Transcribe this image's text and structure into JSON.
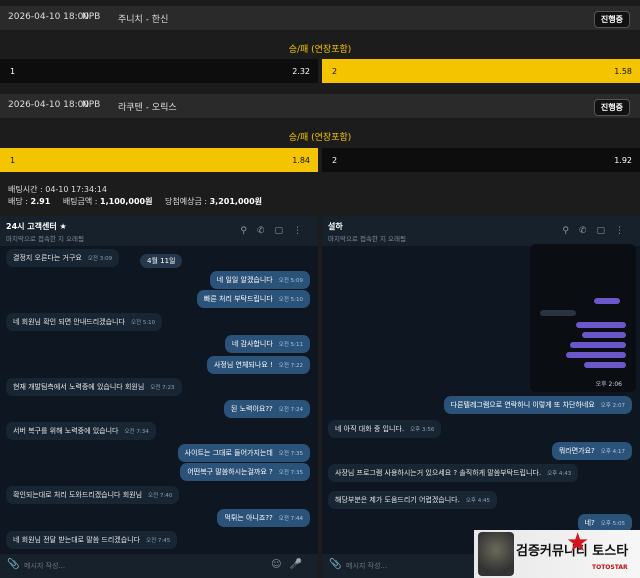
{
  "bets": [
    {
      "date": "2026-04-10 18:00",
      "league": "NPB",
      "match": "주니치 - 한신",
      "status": "진행중",
      "market": "승/패 (연장포함)",
      "options": [
        {
          "label": "1",
          "odds": "2.32",
          "selected": false
        },
        {
          "label": "2",
          "odds": "1.58",
          "selected": true
        }
      ]
    },
    {
      "date": "2026-04-10 18:00",
      "league": "NPB",
      "match": "라쿠텐 - 오릭스",
      "status": "진행중",
      "market": "승/패 (연장포함)",
      "options": [
        {
          "label": "1",
          "odds": "1.84",
          "selected": true
        },
        {
          "label": "2",
          "odds": "1.92",
          "selected": false
        }
      ]
    }
  ],
  "bet_summary": {
    "time_label": "배팅시간 :",
    "time_value": "04-10 17:34:14",
    "odds_label": "배당 :",
    "odds_value": "2.91",
    "amount_label": "배팅금액 :",
    "amount_value": "1,100,000원",
    "win_label": "당첨예상금 :",
    "win_value": "3,201,000원"
  },
  "left_chat": {
    "name": "24시 고객센터 ★",
    "status": "마지막으로 접속한 지 오래됨",
    "date_pill": "4월 11일",
    "input_placeholder": "메시지 작성...",
    "messages": [
      {
        "dir": "in",
        "text": "결정지 오른다는 거구요",
        "time": "오전 3:09"
      },
      {
        "dir": "out",
        "text": "네 일일 알겠습니다",
        "time": "오전 5:09"
      },
      {
        "dir": "out",
        "text": "빠른 처리 부탁드립니다",
        "time": "오전 5:10"
      },
      {
        "dir": "in",
        "text": "네 회원님 확인 되면 안내드리겠습니다",
        "time": "오전 5:10"
      },
      {
        "dir": "out",
        "text": "네 감사합니다",
        "time": "오전 5:11"
      },
      {
        "dir": "out",
        "text": "사정님 연체되나요 !",
        "time": "오전 7:22"
      },
      {
        "dir": "in",
        "text": "현재 개발팀측에서 노력중에 있습니다 회원님",
        "time": "오전 7:23"
      },
      {
        "dir": "out",
        "text": "된 노력이요??",
        "time": "오전 7:24"
      },
      {
        "dir": "in",
        "text": "서버 복구를 위해 노력중에 있습니다",
        "time": "오전 7:34"
      },
      {
        "dir": "out",
        "text": "사이트는 그대로 들어가지는데",
        "time": "오전 7:35"
      },
      {
        "dir": "out",
        "text": "어떤복구 말씀하시는걸까요 ?",
        "time": "오전 7:35"
      },
      {
        "dir": "in",
        "text": "확인되는대로 처리 도와드리겠습니다 회원님",
        "time": "오전 7:40"
      },
      {
        "dir": "out",
        "text": "먹튀는 아니죠??",
        "time": "오전 7:44"
      },
      {
        "dir": "in",
        "text": "네 회원님 전달 받는대로 말씀 드리겠습니다",
        "time": "오전 7:45"
      }
    ]
  },
  "right_chat": {
    "name": "설하",
    "status": "마지막으로 접속한 지 오래됨",
    "input_placeholder": "메시지 작성...",
    "photo_time": "오후 2:06",
    "photo_caption": "",
    "messages": [
      {
        "dir": "out",
        "text": "다른텔레그램으로 연락하니 이렇게 또 차단하네요",
        "time": "오후 2:07"
      },
      {
        "dir": "in",
        "text": "네 아직 대화 중 입니다.",
        "time": "오후 3:56"
      },
      {
        "dir": "out",
        "text": "뭐라면가요?",
        "time": "오후 4:17"
      },
      {
        "dir": "in",
        "text": "사장님 프로그램 사용하시는거 있으세요 ? 솔직하게 말씀부탁드립니다.",
        "time": "오후 4:43"
      },
      {
        "dir": "in",
        "text": "해당부분은 제가 도움드리기 어렵겠습니다.",
        "time": "오후 4:45"
      },
      {
        "dir": "out",
        "text": "네?",
        "time": "오후 5:05"
      }
    ]
  },
  "watermark": {
    "text": "검증커뮤니티 토스타",
    "sub": "TOTOSTAR"
  }
}
